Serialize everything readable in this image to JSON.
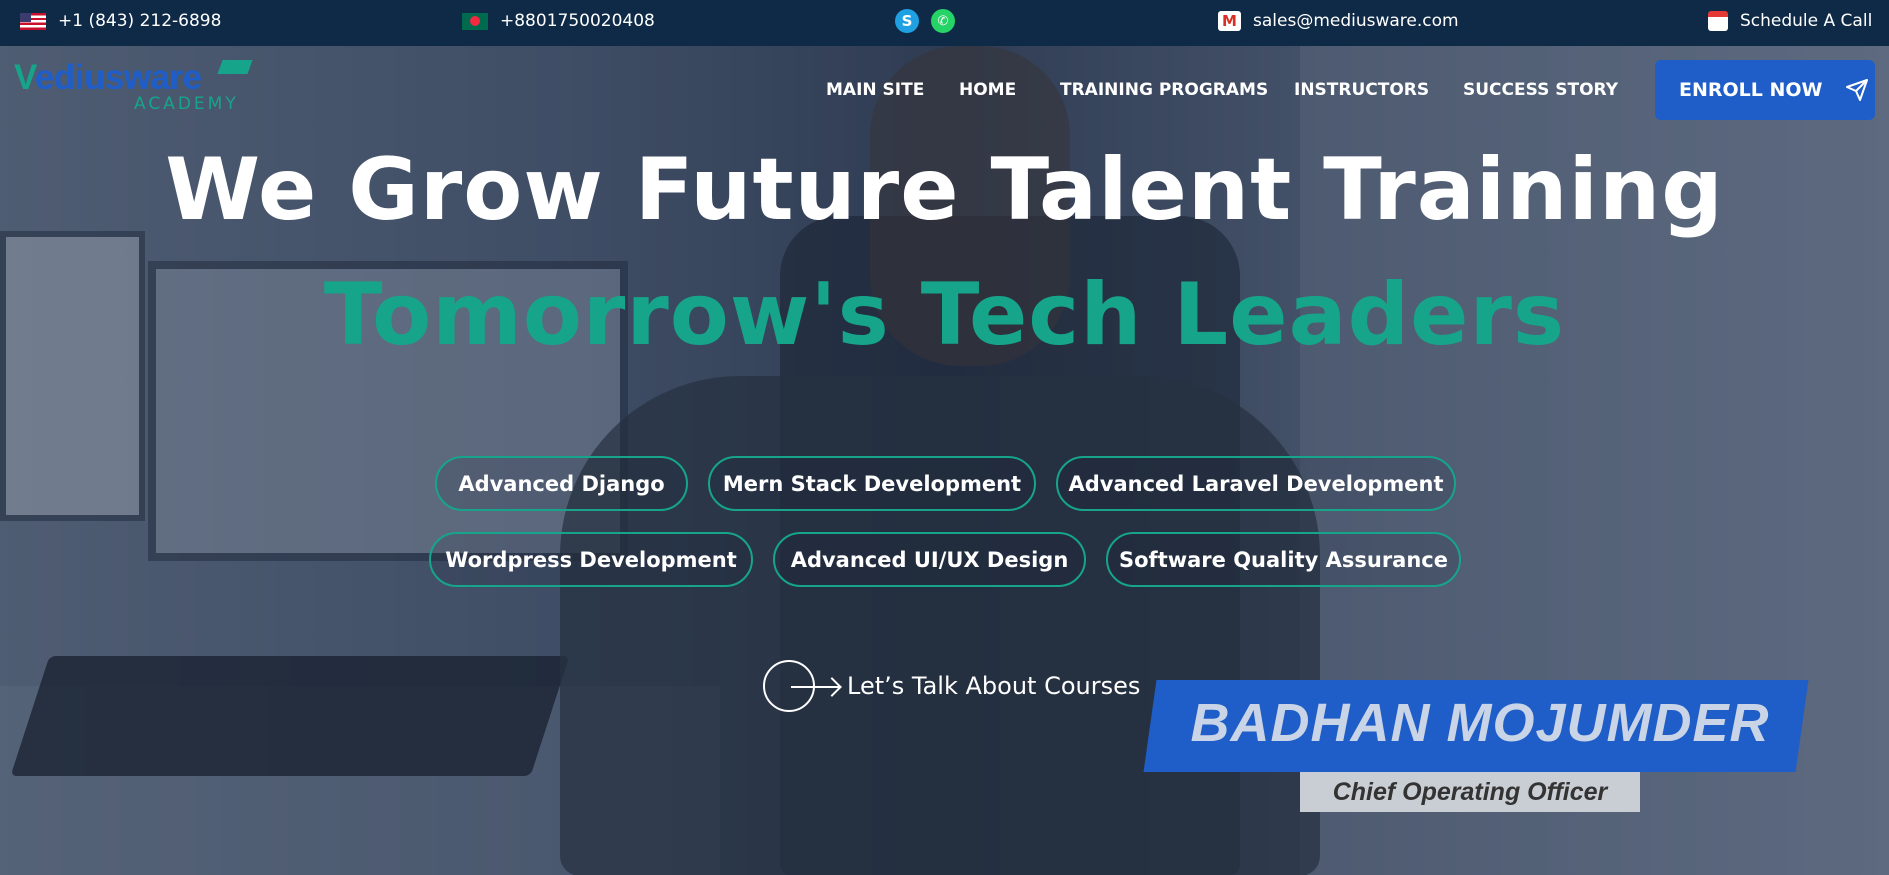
{
  "topbar": {
    "phone_us": "+1 (843) 212-6898",
    "phone_bd": "+8801750020408",
    "email": "sales@mediusware.com",
    "schedule": "Schedule A Call",
    "icons": [
      "us-flag-icon",
      "bd-flag-icon",
      "skype-icon",
      "whatsapp-icon",
      "gmail-icon",
      "calendar-icon"
    ]
  },
  "logo": {
    "main_v": "V",
    "main_rest": "ediusware",
    "sub": "ACADEMY"
  },
  "nav": {
    "items": [
      "MAIN SITE",
      "HOME",
      "TRAINING PROGRAMS",
      "INSTRUCTORS",
      "SUCCESS STORY"
    ],
    "enroll": "ENROLL NOW"
  },
  "hero": {
    "headline": "We Grow Future Talent Training",
    "subheadline": "Tomorrow's Tech Leaders",
    "courses": [
      "Advanced Django",
      "Mern Stack Development",
      "Advanced Laravel Development",
      "Wordpress Development",
      "Advanced UI/UX Design",
      "Software Quality Assurance"
    ],
    "cta": "Let’s Talk About Courses",
    "banner_name": "BADHAN MOJUMDER",
    "banner_role": "Chief Operating Officer"
  },
  "colors": {
    "topbar": "#0e2a47",
    "brand_blue": "#1f5ec8",
    "brand_green": "#16a58a"
  }
}
